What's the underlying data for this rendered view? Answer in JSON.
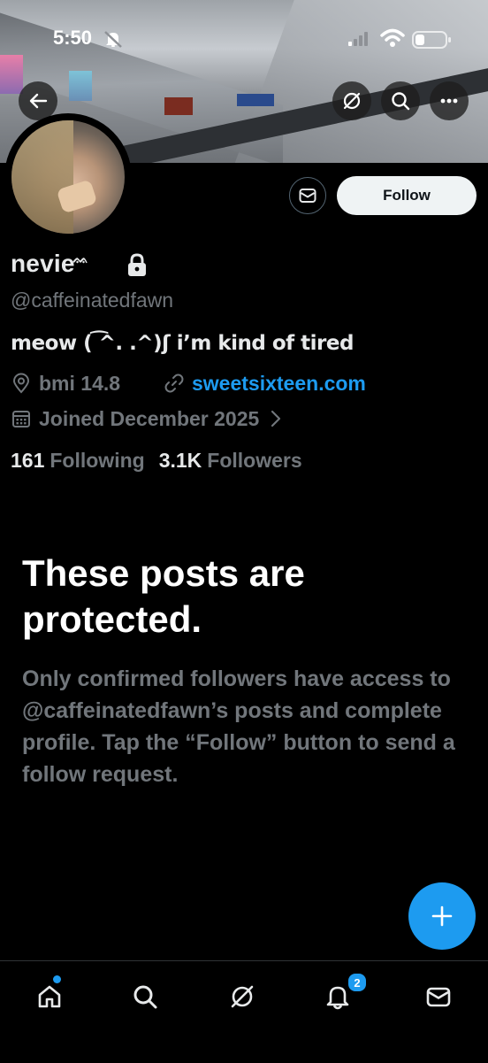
{
  "status_bar": {
    "time": "5:50"
  },
  "profile": {
    "display_name": "nevie",
    "name_decoration": "ᨐ",
    "handle": "@caffeinatedfawn",
    "bio": "meow ( ͡^. .^)ʃ i’m kind of tired",
    "location": "bmi 14.8",
    "website": "sweetsixteen.com",
    "joined": "Joined December 2025",
    "following_count": "161",
    "following_label": "Following",
    "followers_count": "3.1K",
    "followers_label": "Followers"
  },
  "actions": {
    "follow_label": "Follow"
  },
  "protected": {
    "title": "These posts are protected.",
    "body": "Only confirmed followers have access to @caffeinatedfawn’s posts and complete profile. Tap the “Follow” button to send a follow request."
  },
  "nav": {
    "notifications_badge": "2"
  },
  "icons": {
    "back": "arrow-left-icon",
    "grok": "grok-icon",
    "search": "search-icon",
    "more": "more-icon",
    "message": "envelope-icon",
    "lock": "lock-icon",
    "location": "location-pin-icon",
    "link": "link-icon",
    "calendar": "calendar-icon",
    "chevron": "chevron-right-icon",
    "compose": "plus-icon",
    "home": "home-icon",
    "notifications": "bell-icon",
    "messages": "envelope-icon"
  },
  "colors": {
    "accent": "#1d9bf0",
    "secondary_text": "#71767b",
    "primary_text": "#e7e9ea",
    "background": "#000000"
  }
}
